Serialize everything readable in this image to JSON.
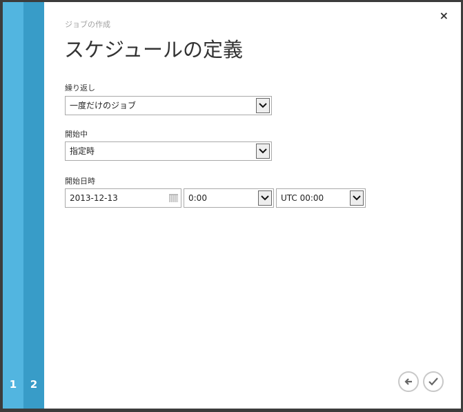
{
  "steps": [
    "1",
    "2"
  ],
  "close_label": "×",
  "subtitle": "ジョブの作成",
  "title": "スケジュールの定義",
  "recurrence": {
    "label": "繰り返し",
    "value": "一度だけのジョブ"
  },
  "start": {
    "label": "開始中",
    "value": "指定時"
  },
  "start_datetime": {
    "label": "開始日時",
    "date": "2013-12-13",
    "time": "0:00",
    "timezone": "UTC 00:00"
  },
  "colors": {
    "step1": "#52b5e0",
    "step2": "#389cc8"
  }
}
